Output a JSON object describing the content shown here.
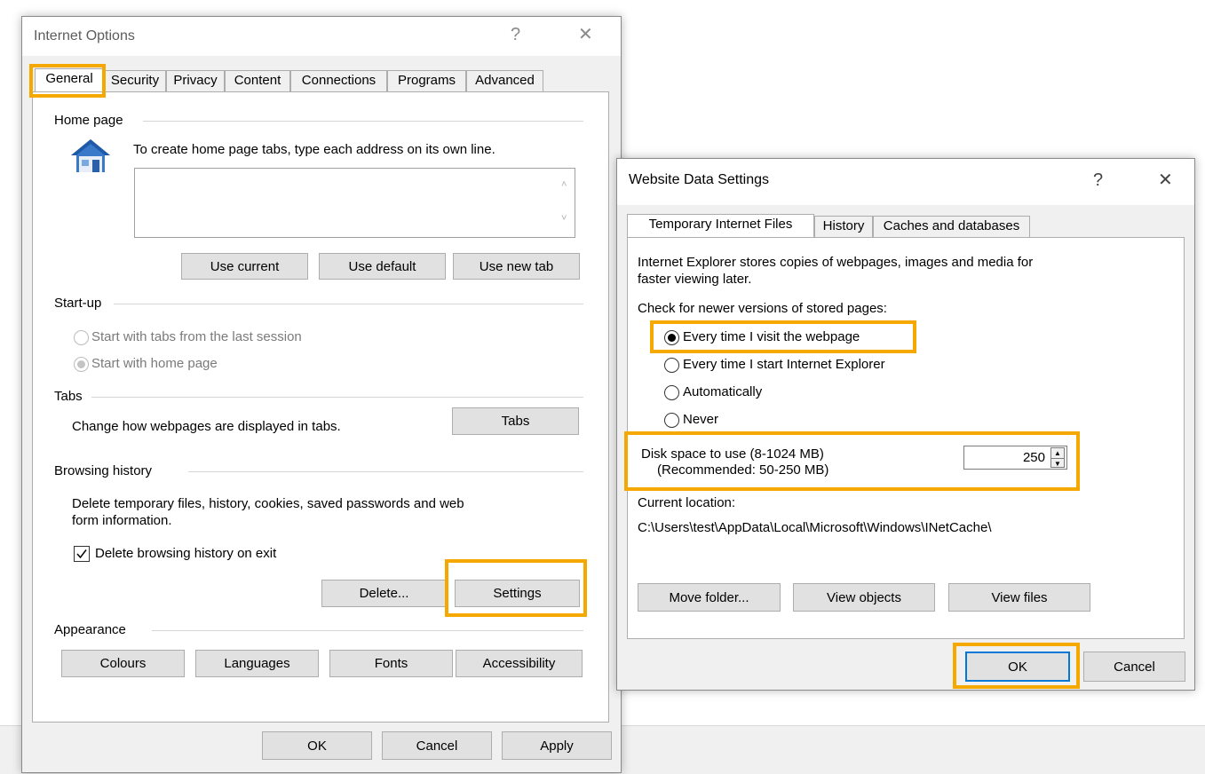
{
  "internet_options": {
    "title": "Internet Options",
    "help_label": "?",
    "close_label": "✕",
    "tabs": [
      "General",
      "Security",
      "Privacy",
      "Content",
      "Connections",
      "Programs",
      "Advanced"
    ],
    "home_page": {
      "group_label": "Home page",
      "description": "To create home page tabs, type each address on its own line.",
      "address_value": "",
      "use_current": "Use current",
      "use_default": "Use default",
      "use_new_tab": "Use new tab"
    },
    "startup": {
      "group_label": "Start-up",
      "option_last_session": "Start with tabs from the last session",
      "option_home_page": "Start with home page",
      "selected": "Start with home page"
    },
    "tabs_group": {
      "group_label": "Tabs",
      "description": "Change how webpages are displayed in tabs.",
      "button": "Tabs"
    },
    "browsing_history": {
      "group_label": "Browsing history",
      "description_line1": "Delete temporary files, history, cookies, saved passwords and web",
      "description_line2": "form information.",
      "delete_on_exit_label": "Delete browsing history on exit",
      "delete_on_exit_checked": true,
      "delete_button": "Delete...",
      "settings_button": "Settings"
    },
    "appearance": {
      "group_label": "Appearance",
      "colours": "Colours",
      "languages": "Languages",
      "fonts": "Fonts",
      "accessibility": "Accessibility"
    },
    "ok": "OK",
    "cancel": "Cancel",
    "apply": "Apply"
  },
  "website_data_settings": {
    "title": "Website Data Settings",
    "help_label": "?",
    "close_label": "✕",
    "tabs": [
      "Temporary Internet Files",
      "History",
      "Caches and databases"
    ],
    "intro_line1": "Internet Explorer stores copies of webpages, images and media for",
    "intro_line2": "faster viewing later.",
    "check_label": "Check for newer versions of stored pages:",
    "options": [
      "Every time I visit the webpage",
      "Every time I start Internet Explorer",
      "Automatically",
      "Never"
    ],
    "selected_option": "Every time I visit the webpage",
    "disk_space_label": "Disk space to use (8-1024 MB)",
    "disk_space_recommended": "(Recommended: 50-250 MB)",
    "disk_space_value": "250",
    "current_location_label": "Current location:",
    "current_location_path": "C:\\Users\\test\\AppData\\Local\\Microsoft\\Windows\\INetCache\\",
    "move_folder": "Move folder...",
    "view_objects": "View objects",
    "view_files": "View files",
    "ok": "OK",
    "cancel": "Cancel"
  },
  "colors": {
    "highlight": "#f5a800",
    "dialog_bg": "#f0f0f0",
    "button_bg": "#e1e1e1",
    "default_button_border": "#0078d7",
    "house_icon": "#3a78c9"
  }
}
